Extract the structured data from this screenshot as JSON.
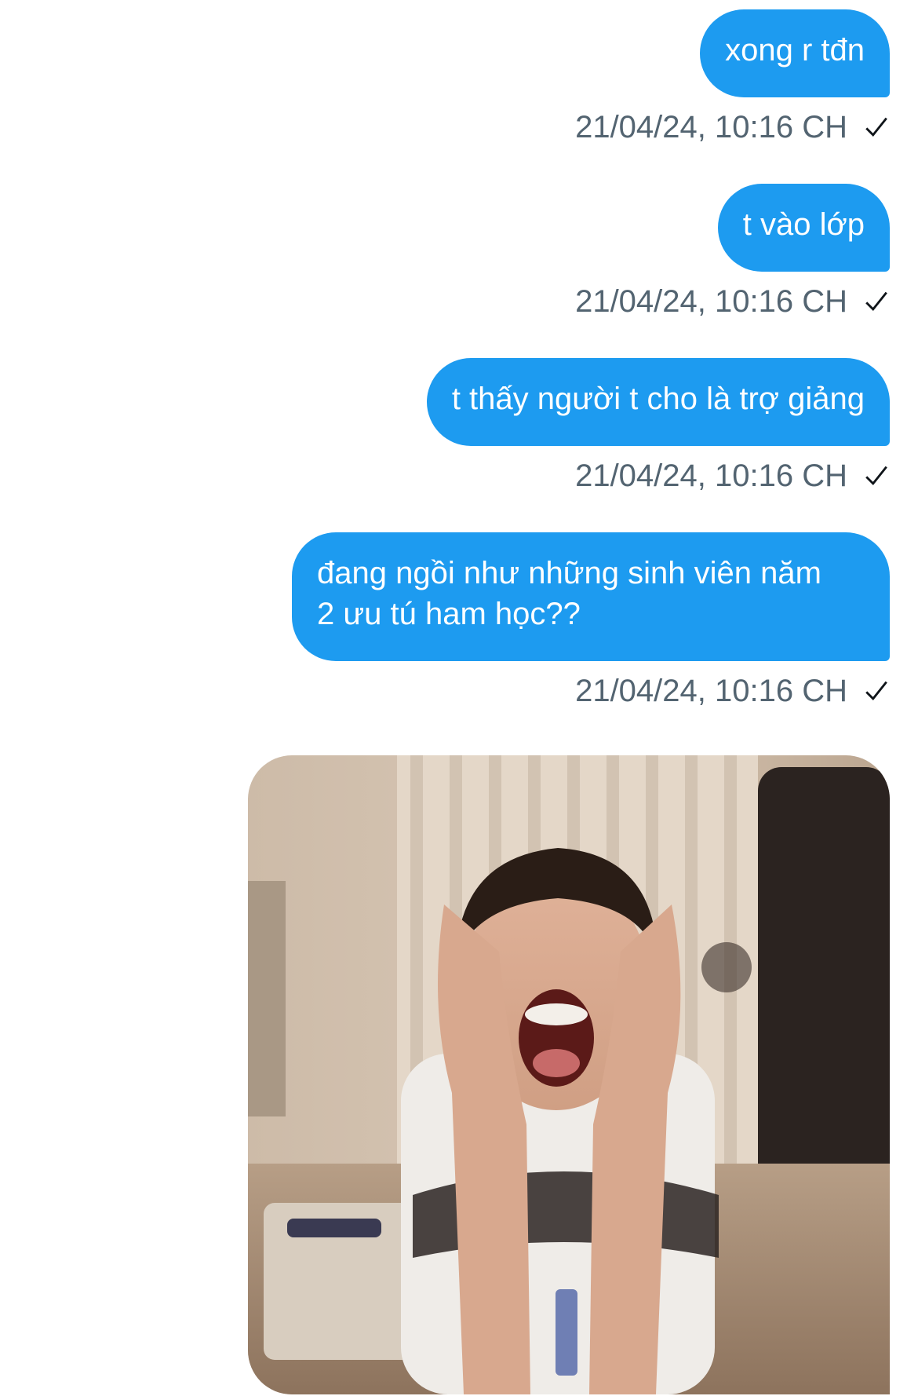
{
  "conversation": {
    "messages": [
      {
        "text": "xong r tđn",
        "timestamp": "21/04/24, 10:16 CH",
        "status_icon": "check-icon"
      },
      {
        "text": "t vào lớp",
        "timestamp": "21/04/24, 10:16 CH",
        "status_icon": "check-icon"
      },
      {
        "text": "t thấy người t cho là trợ giảng",
        "timestamp": "21/04/24, 10:16 CH",
        "status_icon": "check-icon"
      },
      {
        "text": "đang ngồi như những sinh viên năm 2 ưu tú ham học??",
        "timestamp": "21/04/24, 10:16 CH",
        "status_icon": "check-icon"
      }
    ],
    "media": {
      "type": "image",
      "content": "photo of a person clutching their head and screaming"
    }
  },
  "colors": {
    "bubble": "#1d9bf0",
    "bubble_text": "#ffffff",
    "timestamp_text": "#536471",
    "background": "#ffffff"
  }
}
